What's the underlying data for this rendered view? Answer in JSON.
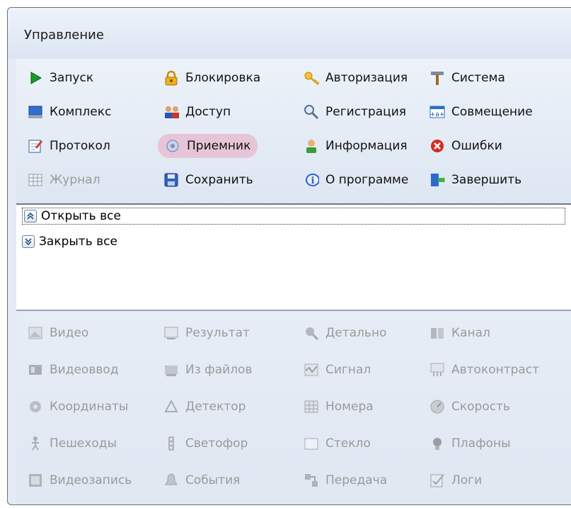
{
  "window": {
    "title": "Управление"
  },
  "toolbar": {
    "items": [
      {
        "label": "Запуск",
        "icon": "play-icon"
      },
      {
        "label": "Блокировка",
        "icon": "lock-icon"
      },
      {
        "label": "Авторизация",
        "icon": "key-icon"
      },
      {
        "label": "Система",
        "icon": "tools-icon"
      },
      {
        "label": "Комплекс",
        "icon": "computer-icon"
      },
      {
        "label": "Доступ",
        "icon": "users-icon"
      },
      {
        "label": "Регистрация",
        "icon": "magnifier-icon"
      },
      {
        "label": "Совмещение",
        "icon": "align-icon"
      },
      {
        "label": "Протокол",
        "icon": "edit-document-icon"
      },
      {
        "label": "Приемник",
        "icon": "receiver-icon"
      },
      {
        "label": "Информация",
        "icon": "user-info-icon"
      },
      {
        "label": "Ошибки",
        "icon": "error-icon"
      },
      {
        "label": "Журнал",
        "icon": "journal-icon"
      },
      {
        "label": "Сохранить",
        "icon": "save-icon"
      },
      {
        "label": "О программе",
        "icon": "info-icon"
      },
      {
        "label": "Завершить",
        "icon": "exit-icon"
      }
    ]
  },
  "list": {
    "items": [
      {
        "label": "Открыть все",
        "icon": "expand-all-icon"
      },
      {
        "label": "Закрыть все",
        "icon": "collapse-all-icon"
      }
    ]
  },
  "modules": {
    "items": [
      {
        "label": "Видео",
        "icon": "video-icon"
      },
      {
        "label": "Результат",
        "icon": "result-icon"
      },
      {
        "label": "Детально",
        "icon": "detail-icon"
      },
      {
        "label": "Канал",
        "icon": "channel-icon"
      },
      {
        "label": "Видеоввод",
        "icon": "video-input-icon"
      },
      {
        "label": "Из файлов",
        "icon": "files-icon"
      },
      {
        "label": "Сигнал",
        "icon": "signal-icon"
      },
      {
        "label": "Автоконтраст",
        "icon": "autocontrast-icon"
      },
      {
        "label": "Координаты",
        "icon": "coordinates-icon"
      },
      {
        "label": "Детектор",
        "icon": "detector-icon"
      },
      {
        "label": "Номера",
        "icon": "plates-icon"
      },
      {
        "label": "Скорость",
        "icon": "speed-icon"
      },
      {
        "label": "Пешеходы",
        "icon": "pedestrian-icon"
      },
      {
        "label": "Светофор",
        "icon": "traffic-light-icon"
      },
      {
        "label": "Стекло",
        "icon": "glass-icon"
      },
      {
        "label": "Плафоны",
        "icon": "lamp-icon"
      },
      {
        "label": "Видеозапись",
        "icon": "record-icon"
      },
      {
        "label": "События",
        "icon": "events-icon"
      },
      {
        "label": "Передача",
        "icon": "transfer-icon"
      },
      {
        "label": "Логи",
        "icon": "logs-icon"
      }
    ]
  },
  "colors": {
    "selected_bg": "#e6c5d8",
    "disabled_text": "#9a9a9a",
    "panel_bg": "#e4ebf5"
  }
}
